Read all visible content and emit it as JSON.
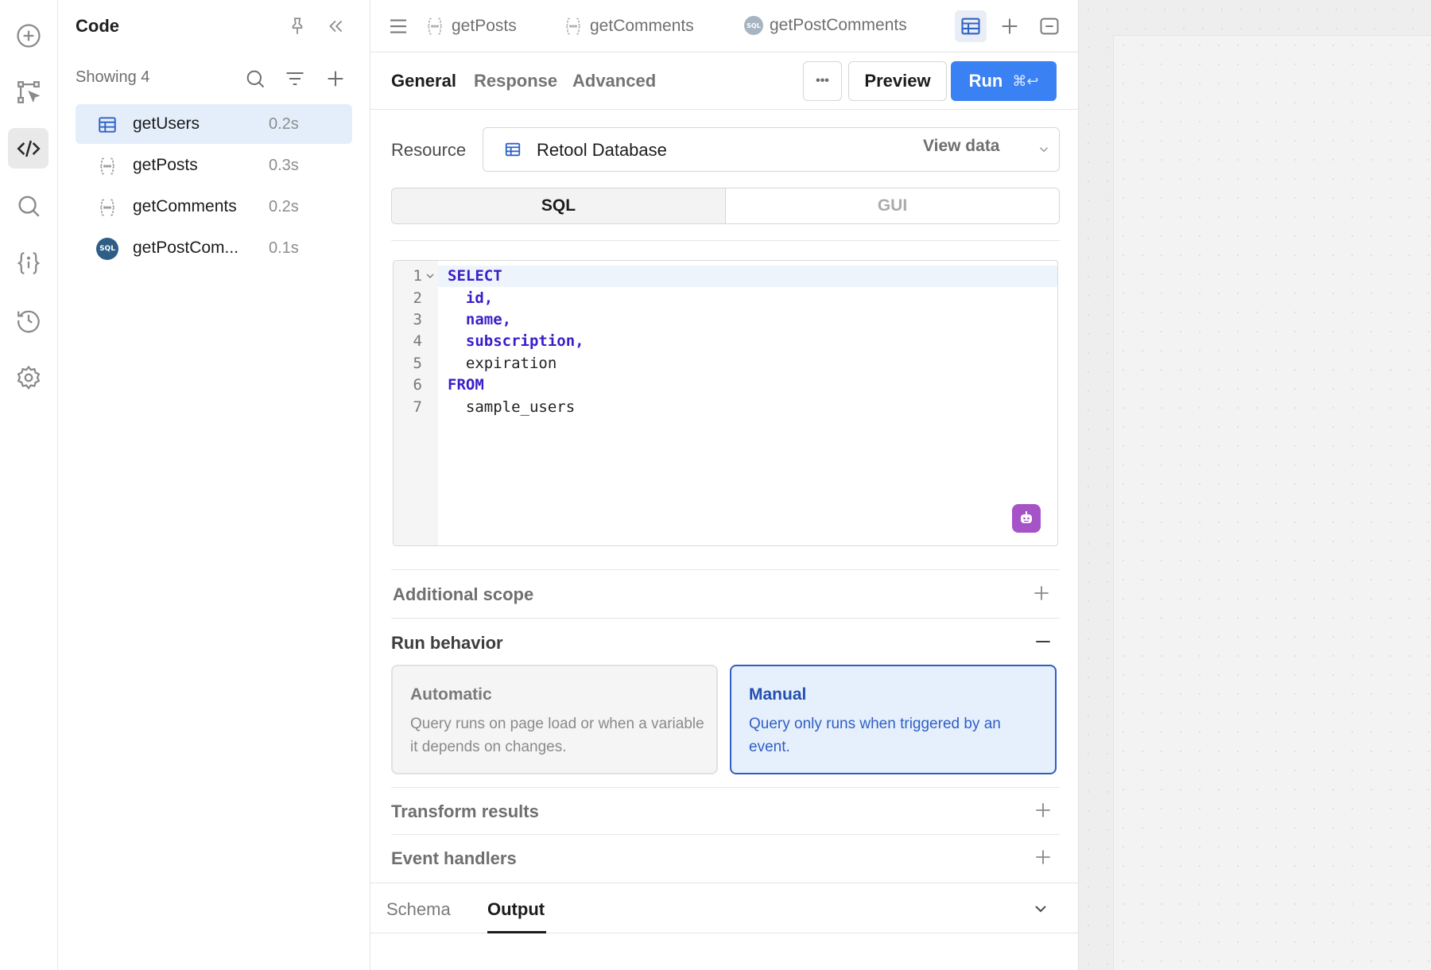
{
  "rail": {
    "icons": [
      "add-icon",
      "cursor-select-icon",
      "code-icon",
      "search-icon",
      "state-icon",
      "history-icon",
      "settings-icon"
    ]
  },
  "code_panel": {
    "title": "Code",
    "showing": "Showing 4",
    "queries": [
      {
        "name": "getUsers",
        "time": "0.2s",
        "icon": "table-icon",
        "active": true
      },
      {
        "name": "getPosts",
        "time": "0.3s",
        "icon": "js-braces-icon",
        "active": false
      },
      {
        "name": "getComments",
        "time": "0.2s",
        "icon": "js-braces-icon",
        "active": false
      },
      {
        "name": "getPostCom...",
        "time": "0.1s",
        "icon": "sql-icon",
        "active": false
      }
    ],
    "sql_badge": "SQL"
  },
  "tabs": {
    "items": [
      {
        "label": "getPosts"
      },
      {
        "label": "getComments"
      },
      {
        "label": "getPostComments"
      }
    ]
  },
  "subtabs": {
    "general": "General",
    "response": "Response",
    "advanced": "Advanced"
  },
  "buttons": {
    "more": "•••",
    "preview": "Preview",
    "run": "Run",
    "run_shortcut": "⌘↩"
  },
  "resource": {
    "label": "Resource",
    "name": "Retool Database",
    "view_data": "View data"
  },
  "mode": {
    "sql": "SQL",
    "gui": "GUI"
  },
  "editor": {
    "lines": [
      {
        "n": "1",
        "text": "SELECT"
      },
      {
        "n": "2",
        "text": "  id,"
      },
      {
        "n": "3",
        "text": "  name,"
      },
      {
        "n": "4",
        "text": "  subscription,"
      },
      {
        "n": "5",
        "text": "  expiration"
      },
      {
        "n": "6",
        "text": "FROM"
      },
      {
        "n": "7",
        "text": "  sample_users"
      }
    ]
  },
  "sections": {
    "additional_scope": "Additional scope",
    "run_behavior": "Run behavior",
    "transform_results": "Transform results",
    "event_handlers": "Event handlers"
  },
  "run_behavior": {
    "automatic": {
      "title": "Automatic",
      "desc": "Query runs on page load or when a variable it depends on changes."
    },
    "manual": {
      "title": "Manual",
      "desc": "Query only runs when triggered by an event."
    }
  },
  "bottom_tabs": {
    "schema": "Schema",
    "output": "Output"
  },
  "colors": {
    "primary": "#3a81f3",
    "active_row": "#e4eefb",
    "keyword": "#3a1fc9",
    "manual_border": "#2e5fc2",
    "ai_badge": "#a653c7"
  }
}
